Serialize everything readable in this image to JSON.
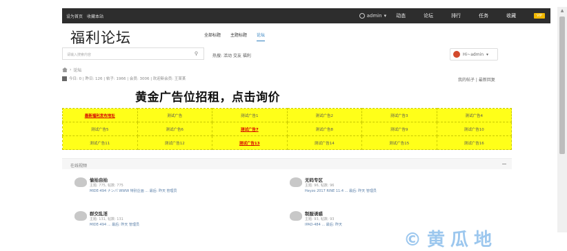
{
  "topbar": {
    "links": [
      "设为首页",
      "收藏本站"
    ],
    "user": "admin",
    "nav": [
      "动态",
      "论坛",
      "排行",
      "任务",
      "收藏"
    ],
    "vip": "VIP"
  },
  "header": {
    "logo": "福利论坛",
    "tabs": [
      "全部标题",
      "主题标题",
      "论坛"
    ]
  },
  "search": {
    "placeholder": "请输入搜索内容",
    "hot_label": "热搜:",
    "hot_tags": "活动 交友 福利"
  },
  "login": {
    "label": "Hi~admin"
  },
  "breadcrumb": [
    "论坛"
  ],
  "stats": "今日: 0 | 昨日: 126 | 帖子: 1966 | 会员: 3006 | 欢迎新会员: 王某某",
  "my_posts": "我的帖子 | 最新回复",
  "ad": {
    "title": "黄金广告位招租，点击询价",
    "rows": [
      [
        {
          "text": "最新福利发布地址",
          "hl": true
        },
        {
          "text": "测试广告",
          "hl": false
        },
        {
          "text": "测试广告1",
          "hl": false
        },
        {
          "text": "测试广告2",
          "hl": false
        },
        {
          "text": "测试广告3",
          "hl": false
        },
        {
          "text": "测试广告4",
          "hl": false
        }
      ],
      [
        {
          "text": "测试广告5",
          "hl": false
        },
        {
          "text": "测试广告6",
          "hl": false
        },
        {
          "text": "测试广告7",
          "hl": true
        },
        {
          "text": "测试广告8",
          "hl": false
        },
        {
          "text": "测试广告9",
          "hl": false
        },
        {
          "text": "测试广告10",
          "hl": false
        }
      ],
      [
        {
          "text": "测试广告11",
          "hl": false
        },
        {
          "text": "测试广告12",
          "hl": false
        },
        {
          "text": "测试广告13",
          "hl": true
        },
        {
          "text": "测试广告14",
          "hl": false
        },
        {
          "text": "测试广告15",
          "hl": false
        },
        {
          "text": "测试广告16",
          "hl": false
        }
      ]
    ]
  },
  "forums": {
    "section_title": "在线视频",
    "items": [
      {
        "name": "偷拍自拍",
        "meta": "主题: 775, 帖数: 775",
        "latest": "MIDE-494 ナンパ WWW 特别企画 ... 最后: 昨天 管理员"
      },
      {
        "name": "无码专区",
        "meta": "主题: 96, 帖数: 96",
        "latest": "Heyzo 2017 RINE 11:4 ... 最后: 昨天 管理员"
      },
      {
        "name": "群交乱淫",
        "meta": "主题: 131, 帖数: 131",
        "latest": "MIDE-494 ... 最后: 昨天 管理员"
      },
      {
        "name": "制服诱惑",
        "meta": "主题: 93, 帖数: 93",
        "latest": "IPAD-484 ... 最后: 昨天"
      }
    ]
  },
  "watermark": "©黄瓜地"
}
